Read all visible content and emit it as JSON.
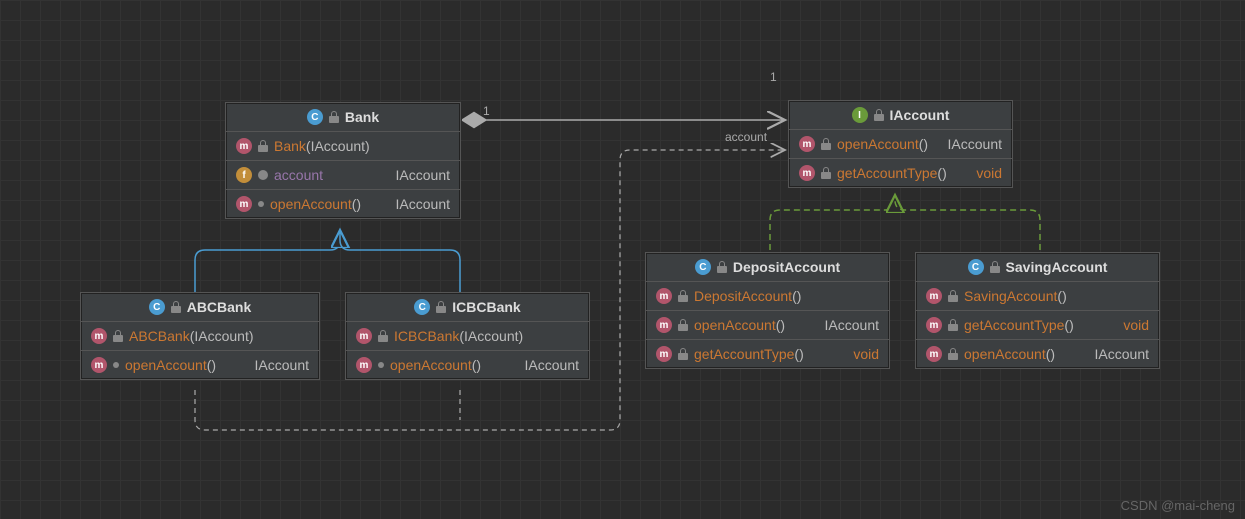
{
  "diagram": {
    "bank": {
      "title": "Bank",
      "kind": "C",
      "rows": [
        {
          "icon": "m",
          "access": "lock",
          "name": "Bank",
          "params": "(IAccount)"
        },
        {
          "icon": "f",
          "access": "key",
          "name": "account",
          "type": "IAccount",
          "field": true
        },
        {
          "icon": "m",
          "access": "dot",
          "name": "openAccount",
          "params": "()",
          "type": "IAccount"
        }
      ]
    },
    "iaccount": {
      "title": "IAccount",
      "kind": "I",
      "rows": [
        {
          "icon": "m",
          "access": "lock",
          "name": "openAccount",
          "params": "()",
          "type": "IAccount"
        },
        {
          "icon": "m",
          "access": "lock",
          "name": "getAccountType",
          "params": "()",
          "type": "void"
        }
      ]
    },
    "abcbank": {
      "title": "ABCBank",
      "kind": "C",
      "rows": [
        {
          "icon": "m",
          "access": "lock",
          "name": "ABCBank",
          "params": "(IAccount)"
        },
        {
          "icon": "m",
          "access": "dot",
          "name": "openAccount",
          "params": "()",
          "type": "IAccount"
        }
      ]
    },
    "icbcbank": {
      "title": "ICBCBank",
      "kind": "C",
      "rows": [
        {
          "icon": "m",
          "access": "lock",
          "name": "ICBCBank",
          "params": "(IAccount)"
        },
        {
          "icon": "m",
          "access": "dot",
          "name": "openAccount",
          "params": "()",
          "type": "IAccount"
        }
      ]
    },
    "deposit": {
      "title": "DepositAccount",
      "kind": "C",
      "rows": [
        {
          "icon": "m",
          "access": "lock",
          "name": "DepositAccount",
          "params": "()"
        },
        {
          "icon": "m",
          "access": "lock",
          "name": "openAccount",
          "params": "()",
          "type": "IAccount"
        },
        {
          "icon": "m",
          "access": "lock",
          "name": "getAccountType",
          "params": "()",
          "type": "void"
        }
      ]
    },
    "saving": {
      "title": "SavingAccount",
      "kind": "C",
      "rows": [
        {
          "icon": "m",
          "access": "lock",
          "name": "SavingAccount",
          "params": "()"
        },
        {
          "icon": "m",
          "access": "lock",
          "name": "getAccountType",
          "params": "()",
          "type": "void"
        },
        {
          "icon": "m",
          "access": "lock",
          "name": "openAccount",
          "params": "()",
          "type": "IAccount"
        }
      ]
    }
  },
  "labels": {
    "account_edge": "account",
    "one_left": "1",
    "one_right": "1"
  },
  "watermark": "CSDN @mai-cheng"
}
